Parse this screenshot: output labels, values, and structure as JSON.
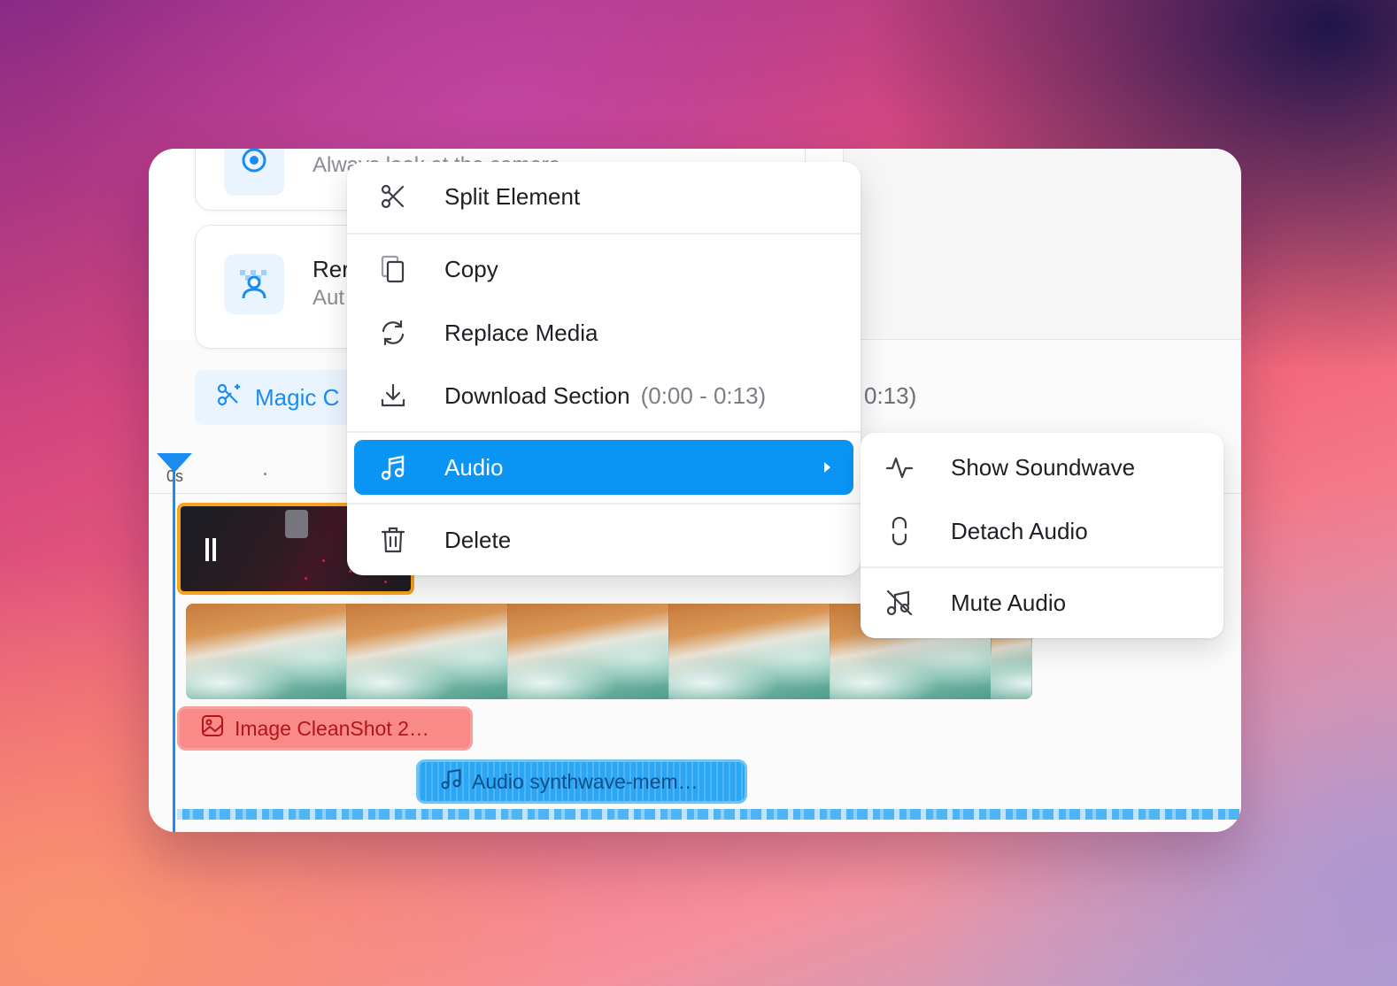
{
  "feature_cards": [
    {
      "title": "",
      "subtitle": "Always look at the camera"
    },
    {
      "title": "Rer",
      "subtitle": "Aut"
    }
  ],
  "toolbar": {
    "magic_label": "Magic C",
    "time_range_tail": "0:13)"
  },
  "ruler": {
    "start_label": "0s"
  },
  "timeline": {
    "image_clip_label": "Image CleanShot 2…",
    "audio_clip_label": "Audio synthwave-mem…"
  },
  "context_menu": {
    "items": [
      {
        "label": "Split Element",
        "icon": "scissors-icon"
      },
      {
        "label": "Copy",
        "icon": "copy-icon"
      },
      {
        "label": "Replace Media",
        "icon": "refresh-icon"
      },
      {
        "label": "Download Section",
        "hint": "(0:00 - 0:13)",
        "icon": "download-icon"
      },
      {
        "label": "Audio",
        "icon": "music-note-icon",
        "active": true
      },
      {
        "label": "Delete",
        "icon": "trash-icon"
      }
    ]
  },
  "audio_submenu": {
    "items": [
      {
        "label": "Show Soundwave",
        "icon": "soundwave-icon"
      },
      {
        "label": "Detach Audio",
        "icon": "detach-icon"
      },
      {
        "label": "Mute Audio",
        "icon": "mute-music-icon"
      }
    ]
  },
  "colors": {
    "accent": "#0a95f5",
    "selection_border": "#f7a31c",
    "image_clip": "#f98a87",
    "audio_clip": "#2aa6f4"
  }
}
